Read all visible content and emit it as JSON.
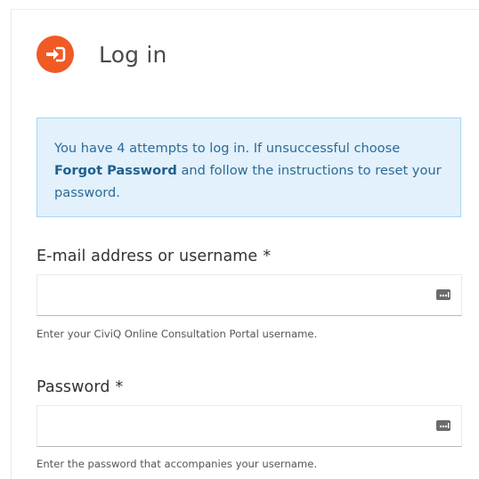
{
  "header": {
    "title": "Log in",
    "icon": "login-arrow-icon",
    "icon_color": "#f05a24"
  },
  "notice": {
    "text_before": "You have 4 attempts to log in. If unsuccessful choose ",
    "link_text": "Forgot Password",
    "text_after": " and follow the instructions to reset your password.",
    "background": "#e2f1fc",
    "text_color": "#2c6a96"
  },
  "fields": {
    "username": {
      "label": "E-mail address or username",
      "required_mark": "*",
      "value": "",
      "help": "Enter your CiviQ Online Consultation Portal username.",
      "icon": "password-manager-icon"
    },
    "password": {
      "label": "Password",
      "required_mark": "*",
      "value": "",
      "help": "Enter the password that accompanies your username.",
      "icon": "password-manager-icon"
    }
  }
}
